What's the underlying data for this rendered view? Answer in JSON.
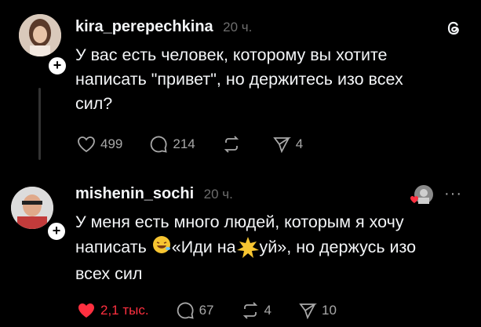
{
  "post1": {
    "username": "kira_perepechkina",
    "time": "20 ч.",
    "text": "У вас есть человек, которому вы хотите написать \"привет\", но держитесь изо всех сил?",
    "likes": "499",
    "replies": "214",
    "reposts": "",
    "shares": "4"
  },
  "post2": {
    "username": "mishenin_sochi",
    "time": "20 ч.",
    "text_line1": "У меня есть много людей, которым я хочу",
    "text_line2_a": "написать",
    "text_line2_b": "«Иди на",
    "text_line2_c": "уй», но держусь изо",
    "text_line3": "всех сил",
    "likes": "2,1 тыс.",
    "replies": "67",
    "reposts": "4",
    "shares": "10",
    "more": "···"
  },
  "colors": {
    "like_red": "#ff3040",
    "muted": "#a8a8a8",
    "background": "#000000"
  }
}
